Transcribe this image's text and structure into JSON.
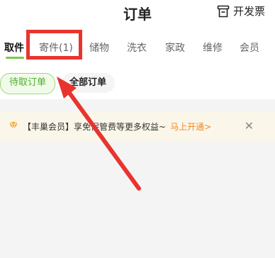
{
  "header": {
    "title": "订单",
    "invoice_label": "开发票"
  },
  "tabs": [
    "取件",
    "寄件(1)",
    "储物",
    "洗衣",
    "家政",
    "维修",
    "会员"
  ],
  "filters": {
    "selected": "待取订单",
    "all": "全部订单"
  },
  "banner": {
    "text": "【丰巢会员】享免保管费等更多权益~",
    "cta": "马上开通>"
  },
  "colors": {
    "accent": "#7ec84a",
    "highlight": "#e8342f",
    "cta": "#f08a1d"
  }
}
